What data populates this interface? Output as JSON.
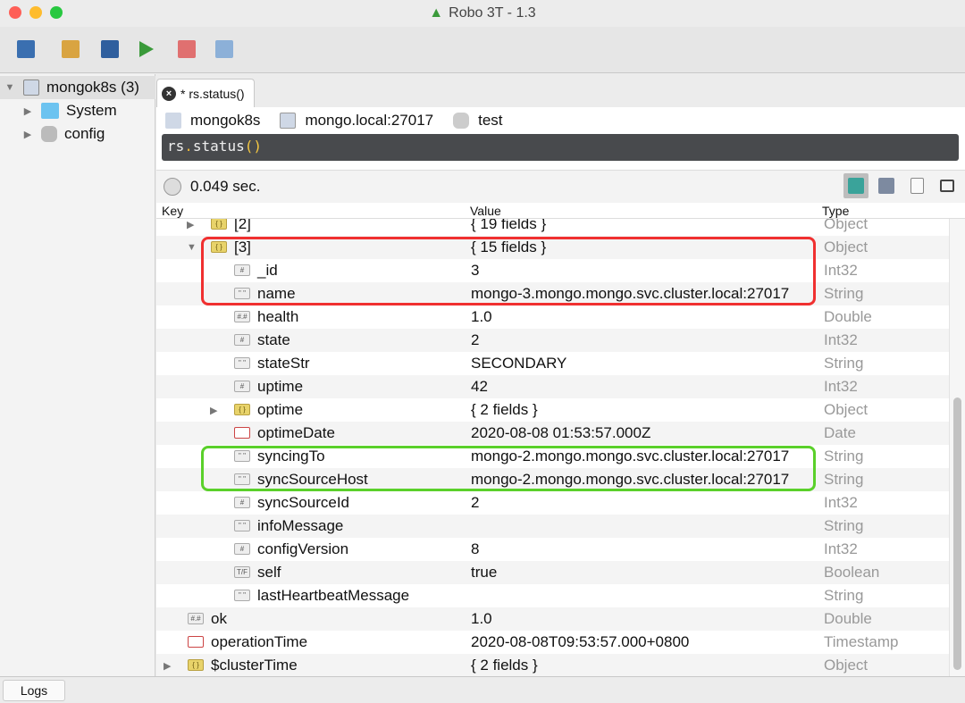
{
  "window": {
    "title": "Robo 3T - 1.3"
  },
  "toolbar": {
    "buttons": [
      {
        "name": "connect-icon",
        "color": "#3a6fb0"
      },
      {
        "name": "open-folder-icon",
        "color": "#d9a441"
      },
      {
        "name": "save-icon",
        "color": "#2f5f9e"
      },
      {
        "name": "run-icon",
        "color": "#3a9a3a"
      },
      {
        "name": "stop-icon",
        "color": "#e07070"
      },
      {
        "name": "refresh-icon",
        "color": "#8cb0d8"
      }
    ]
  },
  "sidebar": {
    "items": [
      {
        "label": "mongok8s (3)",
        "expanded": true,
        "icon": "server-icon"
      },
      {
        "label": "System",
        "expanded": false,
        "icon": "folder-icon"
      },
      {
        "label": "config",
        "expanded": false,
        "icon": "database-icon"
      }
    ]
  },
  "tab": {
    "label": "* rs.status()"
  },
  "connection": {
    "server": "mongok8s",
    "host": "mongo.local:27017",
    "db": "test"
  },
  "editor": {
    "pre": "rs",
    "dot": ".",
    "fn": "status",
    "parens": "()"
  },
  "status": {
    "time": "0.049 sec."
  },
  "table": {
    "headers": {
      "key": "Key",
      "value": "Value",
      "type": "Type"
    },
    "rows": [
      {
        "indent": 2,
        "arrow": "right",
        "icon": "obj",
        "key": "[2]",
        "value": "{ 19 fields }",
        "type": "Object"
      },
      {
        "indent": 2,
        "arrow": "down",
        "icon": "obj",
        "key": "[3]",
        "value": "{ 15 fields }",
        "type": "Object"
      },
      {
        "indent": 3,
        "icon": "int",
        "key": "_id",
        "value": "3",
        "type": "Int32"
      },
      {
        "indent": 3,
        "icon": "str",
        "key": "name",
        "value": "mongo-3.mongo.mongo.svc.cluster.local:27017",
        "type": "String"
      },
      {
        "indent": 3,
        "icon": "dbl",
        "key": "health",
        "value": "1.0",
        "type": "Double"
      },
      {
        "indent": 3,
        "icon": "int",
        "key": "state",
        "value": "2",
        "type": "Int32"
      },
      {
        "indent": 3,
        "icon": "str",
        "key": "stateStr",
        "value": "SECONDARY",
        "type": "String"
      },
      {
        "indent": 3,
        "icon": "int",
        "key": "uptime",
        "value": "42",
        "type": "Int32"
      },
      {
        "indent": 3,
        "arrow": "right",
        "icon": "obj",
        "key": "optime",
        "value": "{ 2 fields }",
        "type": "Object"
      },
      {
        "indent": 3,
        "icon": "date",
        "key": "optimeDate",
        "value": "2020-08-08 01:53:57.000Z",
        "type": "Date"
      },
      {
        "indent": 3,
        "icon": "str",
        "key": "syncingTo",
        "value": "mongo-2.mongo.mongo.svc.cluster.local:27017",
        "type": "String"
      },
      {
        "indent": 3,
        "icon": "str",
        "key": "syncSourceHost",
        "value": "mongo-2.mongo.mongo.svc.cluster.local:27017",
        "type": "String"
      },
      {
        "indent": 3,
        "icon": "int",
        "key": "syncSourceId",
        "value": "2",
        "type": "Int32"
      },
      {
        "indent": 3,
        "icon": "str",
        "key": "infoMessage",
        "value": "",
        "type": "String"
      },
      {
        "indent": 3,
        "icon": "int",
        "key": "configVersion",
        "value": "8",
        "type": "Int32"
      },
      {
        "indent": 3,
        "icon": "bool",
        "key": "self",
        "value": "true",
        "type": "Boolean"
      },
      {
        "indent": 3,
        "icon": "str",
        "key": "lastHeartbeatMessage",
        "value": "",
        "type": "String"
      },
      {
        "indent": 1,
        "icon": "dbl",
        "key": "ok",
        "value": "1.0",
        "type": "Double"
      },
      {
        "indent": 1,
        "icon": "date",
        "key": "operationTime",
        "value": "2020-08-08T09:53:57.000+0800",
        "type": "Timestamp"
      },
      {
        "indent": 1,
        "arrow": "right",
        "icon": "obj",
        "key": "$clusterTime",
        "value": "{ 2 fields }",
        "type": "Object"
      }
    ]
  },
  "highlights": [
    {
      "rows": [
        1,
        3
      ],
      "color": "#f03030"
    },
    {
      "rows": [
        10,
        11
      ],
      "color": "#5ad02a"
    }
  ],
  "bottom": {
    "logs": "Logs"
  }
}
